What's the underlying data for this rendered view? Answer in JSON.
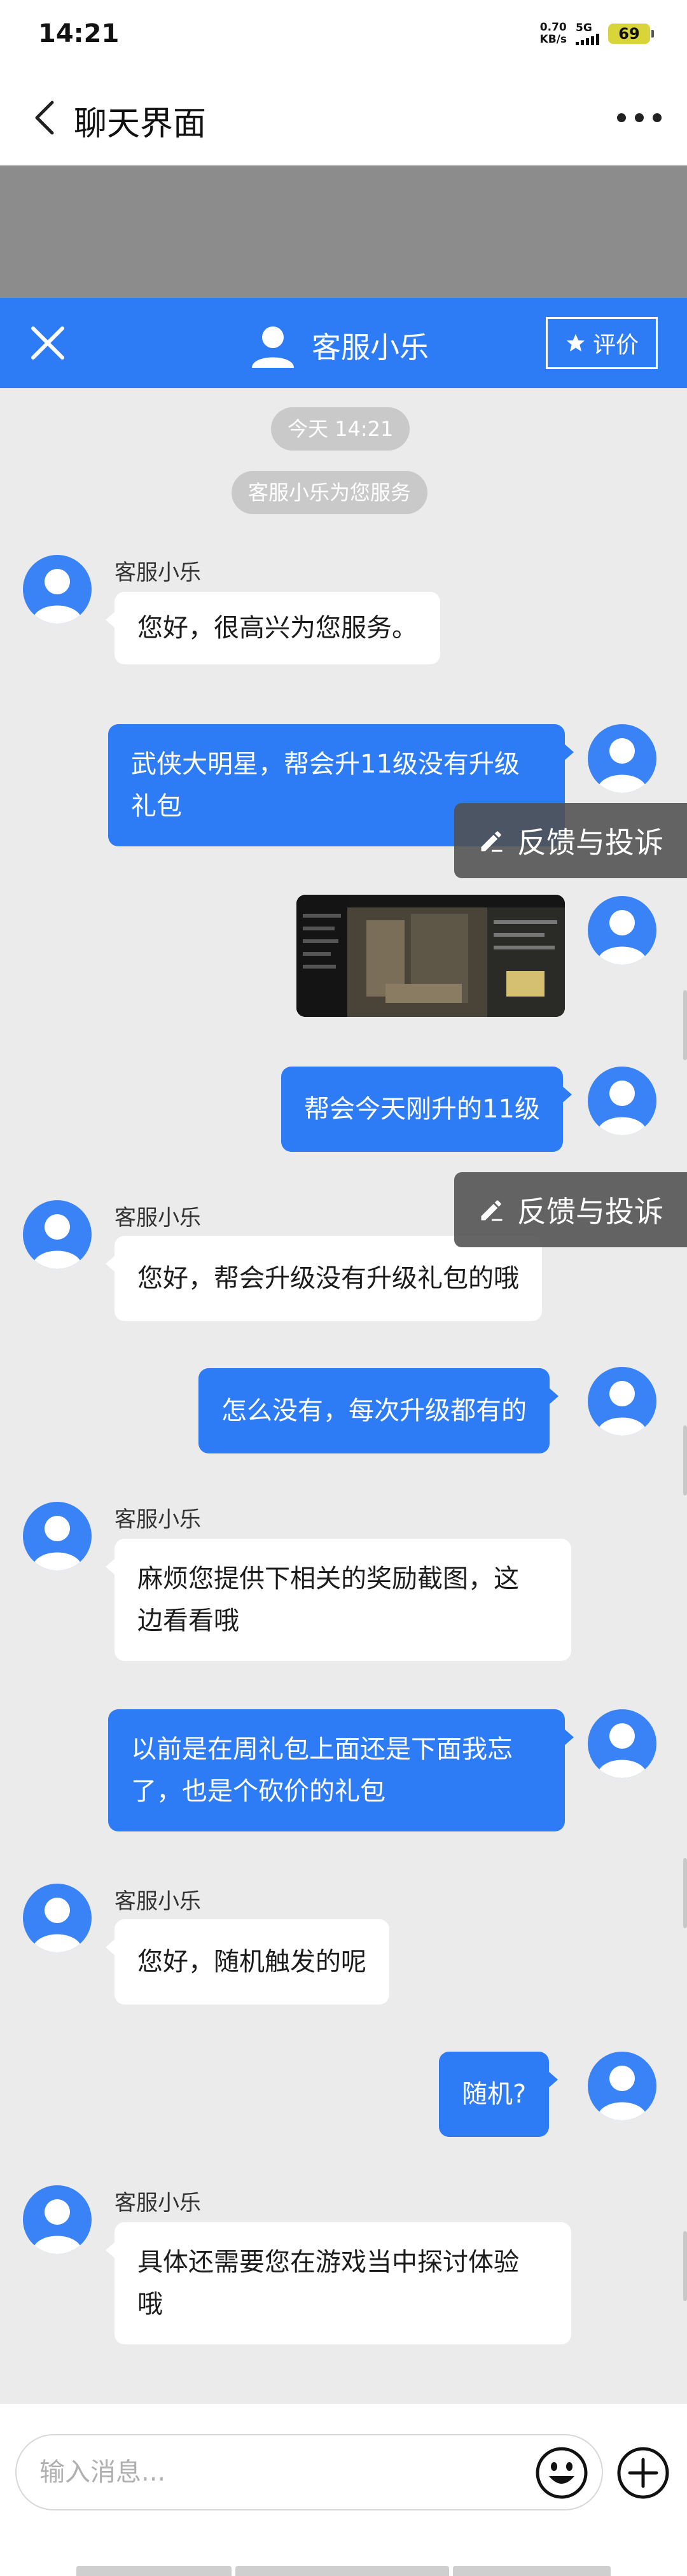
{
  "status_bar": {
    "time": "14:21",
    "net_speed_value": "0.70",
    "net_speed_unit": "KB/s",
    "network": "5G",
    "battery": "69",
    "battery_color": "#d9d43a"
  },
  "nav": {
    "title": "聊天界面",
    "back_icon": "chevron-left-icon",
    "more_icon": "more-dots-icon"
  },
  "chat_header": {
    "agent_name": "客服小乐",
    "rate_label": "评价",
    "close_icon": "close-icon",
    "accent_color": "#2d7cf6"
  },
  "system": {
    "timestamp": "今天 14:21",
    "service_notice": "客服小乐为您服务"
  },
  "messages": [
    {
      "from": "agent",
      "sender": "客服小乐",
      "lines": [
        "您好，很高兴为您服务。"
      ]
    },
    {
      "from": "user",
      "lines": [
        "武侠大明星，帮会升11级没有升级",
        "礼包"
      ]
    },
    {
      "from": "user",
      "type": "image"
    },
    {
      "from": "user",
      "lines": [
        "帮会今天刚升的11级"
      ]
    },
    {
      "from": "agent",
      "sender": "客服小乐",
      "lines": [
        "您好，帮会升级没有升级礼包的哦"
      ]
    },
    {
      "from": "user",
      "lines": [
        "怎么没有，每次升级都有的"
      ]
    },
    {
      "from": "agent",
      "sender": "客服小乐",
      "lines": [
        "麻烦您提供下相关的奖励截图，这",
        "边看看哦"
      ]
    },
    {
      "from": "user",
      "lines": [
        "以前是在周礼包上面还是下面我忘",
        "了，也是个砍价的礼包"
      ]
    },
    {
      "from": "agent",
      "sender": "客服小乐",
      "lines": [
        "您好，随机触发的呢"
      ]
    },
    {
      "from": "user",
      "lines": [
        "随机?"
      ]
    },
    {
      "from": "agent",
      "sender": "客服小乐",
      "lines": [
        "具体还需要您在游戏当中探讨体验",
        "哦"
      ]
    }
  ],
  "feedback": {
    "label": "反馈与投诉",
    "icon": "edit-pencil-icon"
  },
  "input": {
    "placeholder": "输入消息...",
    "emoji_icon": "emoji-icon",
    "plus_icon": "plus-icon"
  }
}
